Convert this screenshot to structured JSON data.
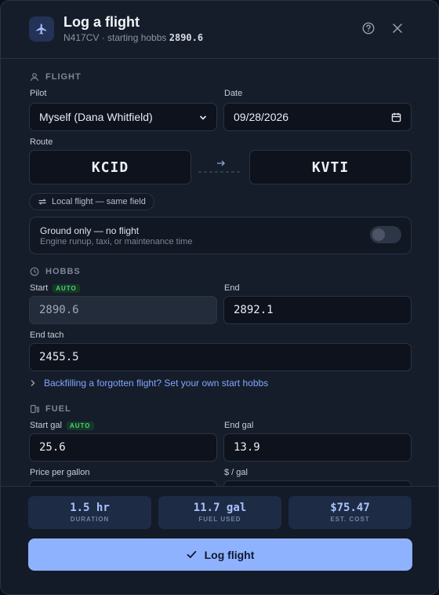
{
  "header": {
    "title": "Log a flight",
    "tail": "N417CV",
    "subtitle_sep": " · starting hobbs ",
    "starting_hobbs": "2890.6"
  },
  "flight": {
    "section": "FLIGHT",
    "pilot_label": "Pilot",
    "pilot_value": "Myself (Dana Whitfield)",
    "date_label": "Date",
    "date_value": "09/28/2026",
    "route_label": "Route",
    "from": "KCID",
    "to": "KVTI",
    "local_pill": "Local flight — same field",
    "ground_title": "Ground only — no flight",
    "ground_desc": "Engine runup, taxi, or maintenance time",
    "ground_only": false
  },
  "hobbs": {
    "section": "HOBBS",
    "start_label": "Start",
    "auto": "AUTO",
    "start_value": "2890.6",
    "end_label": "End",
    "end_value": "2892.1",
    "tach_label": "End tach",
    "tach_value": "2455.5",
    "backfill": "Backfilling a forgotten flight? Set your own start hobbs"
  },
  "fuel": {
    "section": "FUEL",
    "start_label": "Start gal",
    "auto": "AUTO",
    "start_value": "25.6",
    "end_label": "End gal",
    "end_value": "13.9",
    "price_label": "Price per gallon",
    "rate_label": "$ / gal"
  },
  "summary": {
    "duration_value": "1.5 hr",
    "duration_label": "DURATION",
    "fuel_value": "11.7 gal",
    "fuel_label": "FUEL USED",
    "cost_value": "$75.47",
    "cost_label": "EST. COST"
  },
  "submit_label": "Log flight",
  "colors": {
    "accent": "#8fb2ff",
    "auto": "#4ad07a",
    "link": "#7fa7ff"
  }
}
